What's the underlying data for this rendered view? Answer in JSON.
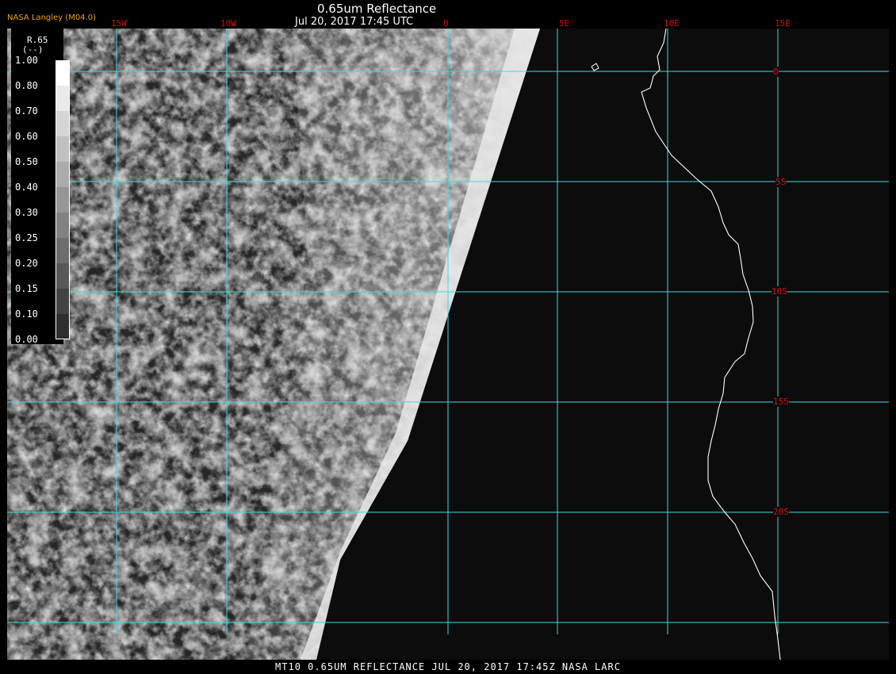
{
  "header": {
    "credit": "NASA Langley (M04.0)",
    "title": "0.65um Reflectance",
    "date": "Jul 20, 2017 17:45 UTC"
  },
  "legend": {
    "title": "R.65",
    "units": "(--)",
    "ticks": [
      "1.00",
      "0.80",
      "0.70",
      "0.60",
      "0.50",
      "0.40",
      "0.30",
      "0.25",
      "0.20",
      "0.15",
      "0.10",
      "0.00"
    ]
  },
  "grid": {
    "longitudes": [
      "15W",
      "10W",
      "0",
      "5E",
      "10E",
      "15E"
    ],
    "latitudes": [
      "0",
      "5S",
      "10S",
      "15S",
      "20S"
    ],
    "line_color": "#40d8e0",
    "label_color": "#d01010"
  },
  "footer": "MT10  0.65UM REFLECTANCE   JUL 20, 2017 17:45Z   NASA LARC",
  "colors": {
    "coastline": "#ffffff",
    "background": "#0c0c0c",
    "cloud": "#c8c8c8"
  }
}
